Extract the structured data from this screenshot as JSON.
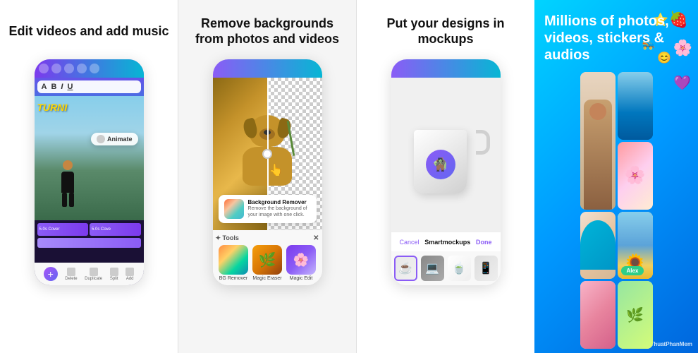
{
  "panel1": {
    "title": "Edit videos and add music",
    "animate_label": "Animate",
    "turni_text": "TURNI",
    "timeline_clips": [
      "5.0s Cover",
      "5.0s Cove"
    ],
    "bottom_actions": [
      "Delete",
      "Duplicate",
      "Split",
      "Add"
    ]
  },
  "panel2": {
    "title": "Remove backgrounds from photos and videos",
    "bg_remover_title": "Background Remover",
    "bg_remover_desc": "Remove the background of your image with one click.",
    "tools_label": "✦ Tools",
    "tools": [
      "BG Remover",
      "Magic Eraser",
      "Magic Edit"
    ]
  },
  "panel3": {
    "title": "Put your designs in mockups",
    "cancel_label": "Cancel",
    "mockups_label": "Smartmockups",
    "done_label": "Done"
  },
  "panel4": {
    "title": "Millions of photos, videos, stickers & audios",
    "name_badge": "Alex",
    "watermark": "ThuThuatPhanMem"
  },
  "decorations": {
    "strawberry": "🍓",
    "star": "⭐",
    "flower": "🌸",
    "smiley": "😊",
    "heart": "💜",
    "sparkle": "✦",
    "plus": "+",
    "rollerblade": "🛼",
    "character": "🧌"
  }
}
